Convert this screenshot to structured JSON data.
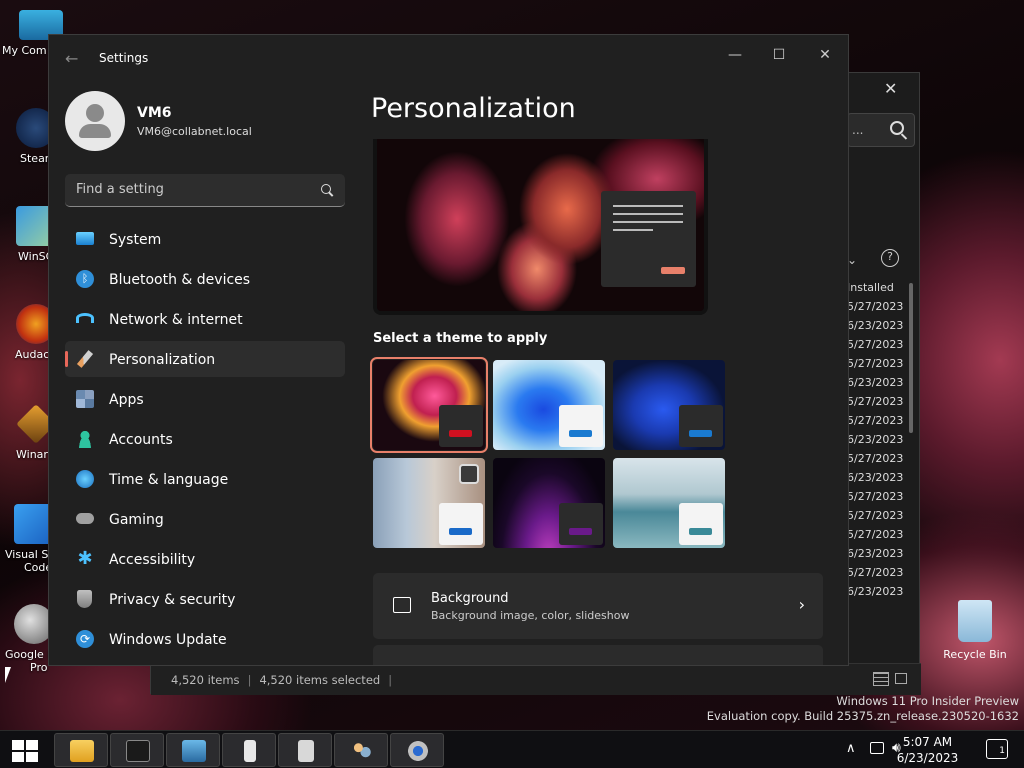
{
  "desktop": {
    "icons": [
      {
        "label": "My Com",
        "icon": "computer-icon"
      },
      {
        "label": "Stean",
        "icon": "steam-icon"
      },
      {
        "label": "WinSC",
        "icon": "winscp-icon"
      },
      {
        "label": "Audac",
        "icon": "audacity-icon"
      },
      {
        "label": "Winar",
        "icon": "winamp-icon"
      },
      {
        "label": "Visual St",
        "label2": "Code",
        "icon": "vscode-icon"
      },
      {
        "label": "Google I",
        "label2": "Pro",
        "icon": "google-earth-icon",
        "badge": "Pro"
      }
    ],
    "recycle_bin": "Recycle Bin",
    "watermark_line1": "Windows 11 Pro Insider Preview",
    "watermark_line2": "Evaluation copy. Build 25375.zn_release.230520-1632"
  },
  "explorer": {
    "search_partial": "...",
    "column_header": "Installed",
    "dates": [
      "5/27/2023",
      "6/23/2023",
      "5/27/2023",
      "5/27/2023",
      "6/23/2023",
      "5/27/2023",
      "5/27/2023",
      "6/23/2023",
      "5/27/2023",
      "6/23/2023",
      "5/27/2023",
      "5/27/2023",
      "5/27/2023",
      "6/23/2023",
      "5/27/2023",
      "6/23/2023"
    ],
    "status_items": "4,520 items",
    "status_selected": "4,520 items selected",
    "status_sep": "|"
  },
  "settings": {
    "app_title": "Settings",
    "back_glyph": "←",
    "minimize_glyph": "—",
    "maximize_glyph": "☐",
    "close_glyph": "✕",
    "user_name": "VM6",
    "user_email": "VM6@collabnet.local",
    "search_placeholder": "Find a setting",
    "nav": [
      {
        "label": "System",
        "icon": "system-icon",
        "color": "#4cc2ff"
      },
      {
        "label": "Bluetooth & devices",
        "icon": "bluetooth-icon",
        "color": "#2f8fd8"
      },
      {
        "label": "Network & internet",
        "icon": "wifi-icon",
        "color": "#4cc2ff"
      },
      {
        "label": "Personalization",
        "icon": "paintbrush-icon",
        "color": "#e8a060",
        "selected": true
      },
      {
        "label": "Apps",
        "icon": "apps-icon",
        "color": "#a0b8d8"
      },
      {
        "label": "Accounts",
        "icon": "accounts-icon",
        "color": "#2ec4a0"
      },
      {
        "label": "Time & language",
        "icon": "globe-clock-icon",
        "color": "#4cc2ff"
      },
      {
        "label": "Gaming",
        "icon": "gamepad-icon",
        "color": "#a0a0a0"
      },
      {
        "label": "Accessibility",
        "icon": "accessibility-icon",
        "color": "#4cc2ff"
      },
      {
        "label": "Privacy & security",
        "icon": "shield-icon",
        "color": "#a0a0a0"
      },
      {
        "label": "Windows Update",
        "icon": "update-icon",
        "color": "#2f8fd8"
      }
    ],
    "page_title": "Personalization",
    "theme_section_label": "Select a theme to apply",
    "themes": [
      {
        "name": "theme-glow-dark",
        "selected": true,
        "accent": "#d01020"
      },
      {
        "name": "theme-bloom-light",
        "selected": false,
        "accent": "#1a7ad0"
      },
      {
        "name": "theme-bloom-dark",
        "selected": false,
        "accent": "#1a7ad0"
      },
      {
        "name": "theme-spotlight",
        "selected": false,
        "accent": "#1a6ac8"
      },
      {
        "name": "theme-captured-motion",
        "selected": false,
        "accent": "#6a1a8a"
      },
      {
        "name": "theme-flow",
        "selected": false,
        "accent": "#3a8a98"
      }
    ],
    "background_card": {
      "title": "Background",
      "subtitle": "Background image, color, slideshow",
      "chevron": "›"
    }
  },
  "taskbar": {
    "apps": [
      "file-explorer-icon",
      "terminal-icon",
      "remote-desktop-icon",
      "registry-icon",
      "document-icon",
      "users-icon",
      "settings-gear-icon"
    ],
    "time": "5:07 AM",
    "date": "6/23/2023",
    "notification_count": "1",
    "tray_chevron": "∧"
  },
  "colors": {
    "accent": "#e8806a",
    "window_bg": "#202020",
    "card_bg": "#2b2b2b"
  }
}
